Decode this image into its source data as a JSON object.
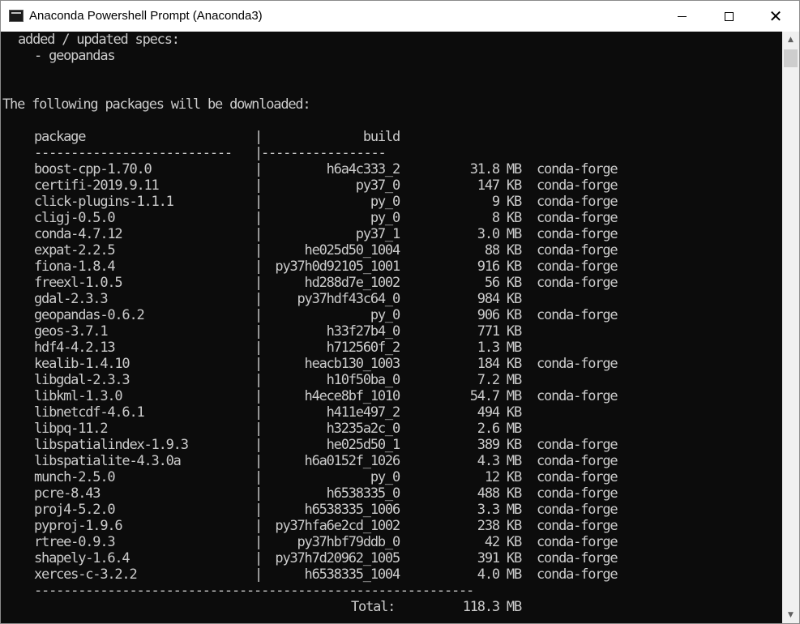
{
  "window": {
    "title": "Anaconda Powershell Prompt (Anaconda3)",
    "minimize_glyph": "",
    "close_glyph": "✕"
  },
  "console": {
    "specs_header": "added / updated specs:",
    "specs": [
      "- geopandas"
    ],
    "download_header": "The following packages will be downloaded:",
    "col_package": "package",
    "col_build": "build",
    "rule_package": "---------------------------",
    "rule_build": "-----------------",
    "pipe": "|",
    "packages": [
      {
        "name": "boost-cpp-1.70.0",
        "build": "h6a4c333_2",
        "size": "31.8 MB",
        "channel": "conda-forge"
      },
      {
        "name": "certifi-2019.9.11",
        "build": "py37_0",
        "size": "147 KB",
        "channel": "conda-forge"
      },
      {
        "name": "click-plugins-1.1.1",
        "build": "py_0",
        "size": "9 KB",
        "channel": "conda-forge"
      },
      {
        "name": "cligj-0.5.0",
        "build": "py_0",
        "size": "8 KB",
        "channel": "conda-forge"
      },
      {
        "name": "conda-4.7.12",
        "build": "py37_1",
        "size": "3.0 MB",
        "channel": "conda-forge"
      },
      {
        "name": "expat-2.2.5",
        "build": "he025d50_1004",
        "size": "88 KB",
        "channel": "conda-forge"
      },
      {
        "name": "fiona-1.8.4",
        "build": "py37h0d92105_1001",
        "size": "916 KB",
        "channel": "conda-forge"
      },
      {
        "name": "freexl-1.0.5",
        "build": "hd288d7e_1002",
        "size": "56 KB",
        "channel": "conda-forge"
      },
      {
        "name": "gdal-2.3.3",
        "build": "py37hdf43c64_0",
        "size": "984 KB",
        "channel": ""
      },
      {
        "name": "geopandas-0.6.2",
        "build": "py_0",
        "size": "906 KB",
        "channel": "conda-forge"
      },
      {
        "name": "geos-3.7.1",
        "build": "h33f27b4_0",
        "size": "771 KB",
        "channel": ""
      },
      {
        "name": "hdf4-4.2.13",
        "build": "h712560f_2",
        "size": "1.3 MB",
        "channel": ""
      },
      {
        "name": "kealib-1.4.10",
        "build": "heacb130_1003",
        "size": "184 KB",
        "channel": "conda-forge"
      },
      {
        "name": "libgdal-2.3.3",
        "build": "h10f50ba_0",
        "size": "7.2 MB",
        "channel": ""
      },
      {
        "name": "libkml-1.3.0",
        "build": "h4ece8bf_1010",
        "size": "54.7 MB",
        "channel": "conda-forge"
      },
      {
        "name": "libnetcdf-4.6.1",
        "build": "h411e497_2",
        "size": "494 KB",
        "channel": ""
      },
      {
        "name": "libpq-11.2",
        "build": "h3235a2c_0",
        "size": "2.6 MB",
        "channel": ""
      },
      {
        "name": "libspatialindex-1.9.3",
        "build": "he025d50_1",
        "size": "389 KB",
        "channel": "conda-forge"
      },
      {
        "name": "libspatialite-4.3.0a",
        "build": "h6a0152f_1026",
        "size": "4.3 MB",
        "channel": "conda-forge"
      },
      {
        "name": "munch-2.5.0",
        "build": "py_0",
        "size": "12 KB",
        "channel": "conda-forge"
      },
      {
        "name": "pcre-8.43",
        "build": "h6538335_0",
        "size": "488 KB",
        "channel": "conda-forge"
      },
      {
        "name": "proj4-5.2.0",
        "build": "h6538335_1006",
        "size": "3.3 MB",
        "channel": "conda-forge"
      },
      {
        "name": "pyproj-1.9.6",
        "build": "py37hfa6e2cd_1002",
        "size": "238 KB",
        "channel": "conda-forge"
      },
      {
        "name": "rtree-0.9.3",
        "build": "py37hbf79ddb_0",
        "size": "42 KB",
        "channel": "conda-forge"
      },
      {
        "name": "shapely-1.6.4",
        "build": "py37h7d20962_1005",
        "size": "391 KB",
        "channel": "conda-forge"
      },
      {
        "name": "xerces-c-3.2.2",
        "build": "h6538335_1004",
        "size": "4.0 MB",
        "channel": "conda-forge"
      }
    ],
    "total_rule": "------------------------------------------------------------",
    "total_label": "Total:",
    "total_value": "118.3 MB"
  },
  "scrollbar": {
    "up_glyph": "▲",
    "down_glyph": "▼"
  }
}
